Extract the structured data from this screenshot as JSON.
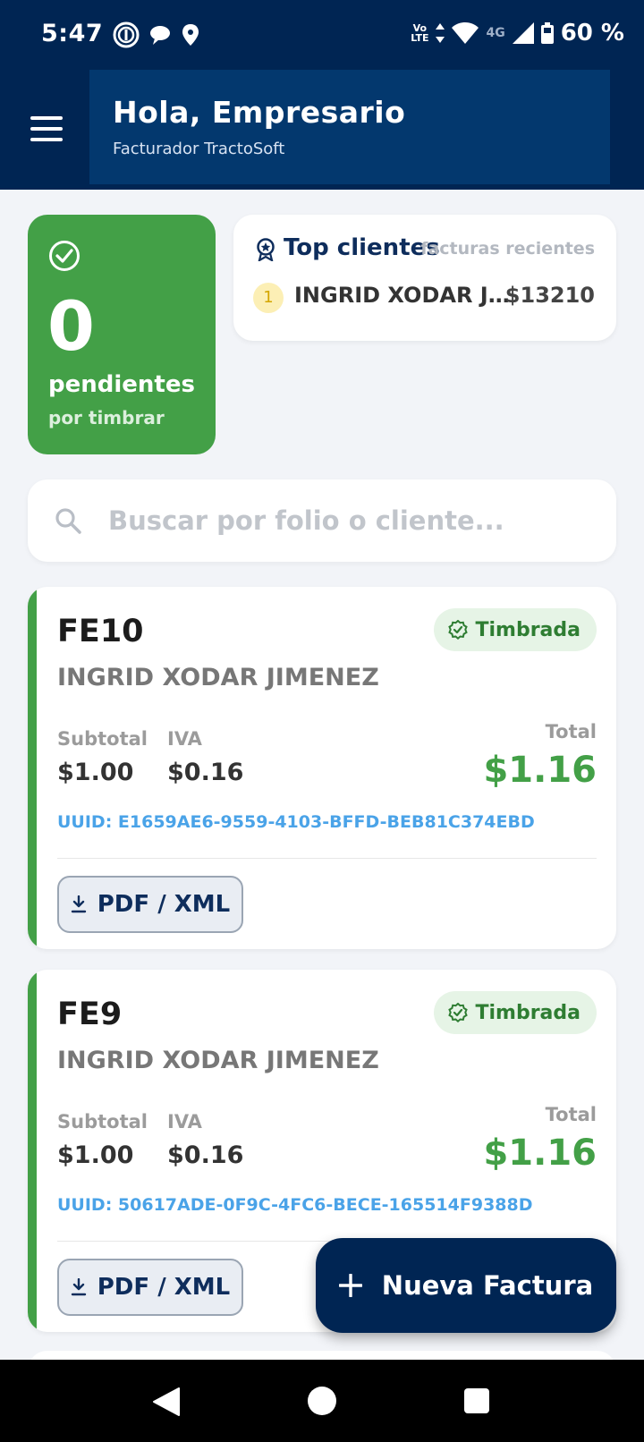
{
  "status_bar": {
    "time": "5:47",
    "battery": "60 %",
    "volte_top": "Vo",
    "volte_bottom": "LTE",
    "network": "4G"
  },
  "header": {
    "title": "Hola, Empresario",
    "subtitle": "Facturador TractoSoft"
  },
  "pending": {
    "count": "0",
    "label": "pendientes",
    "sublabel": "por timbrar"
  },
  "top_clients": {
    "title": "Top clientes",
    "caption": "facturas recientes",
    "items": [
      {
        "rank": "1",
        "name": "INGRID XODAR J…",
        "amount": "$13210"
      }
    ]
  },
  "search": {
    "placeholder": "Buscar por folio o cliente...",
    "value": ""
  },
  "invoices": [
    {
      "folio": "FE10",
      "status": "Timbrada",
      "client": "INGRID XODAR JIMENEZ",
      "subtotal_label": "Subtotal",
      "subtotal": "$1.00",
      "iva_label": "IVA",
      "iva": "$0.16",
      "total_label": "Total",
      "total": "$1.16",
      "uuid": "UUID: E1659AE6-9559-4103-BFFD-BEB81C374EBD",
      "download_label": "PDF / XML"
    },
    {
      "folio": "FE9",
      "status": "Timbrada",
      "client": "INGRID XODAR JIMENEZ",
      "subtotal_label": "Subtotal",
      "subtotal": "$1.00",
      "iva_label": "IVA",
      "iva": "$0.16",
      "total_label": "Total",
      "total": "$1.16",
      "uuid": "UUID: 50617ADE-0F9C-4FC6-BECE-165514F9388D",
      "download_label": "PDF / XML"
    }
  ],
  "fab": {
    "label": "Nueva Factura"
  },
  "colors": {
    "primary": "#002553",
    "accent_green": "#43a047",
    "uuid_blue": "#4aa3e8"
  }
}
